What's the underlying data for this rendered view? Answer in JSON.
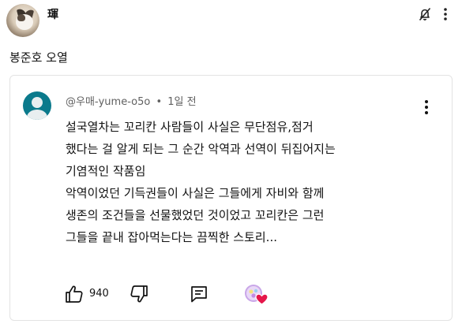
{
  "post": {
    "username": "琿",
    "text": "봉준호 오열"
  },
  "comment": {
    "handle": "@우매-yume-o5o",
    "dot": "•",
    "time": "1일 전",
    "lines": [
      "설국열차는 꼬리칸 사람들이 사실은 무단점유,점거",
      "했다는 걸 알게 되는 그 순간 악역과 선역이 뒤집어지는",
      "기염적인 작품임",
      "악역이었던 기득권들이 사실은 그들에게 자비와 함께",
      "생존의 조건들을 선물했었던 것이었고 꼬리칸은 그런",
      "그들을 끝내 잡아먹는다는 끔찍한 스토리..."
    ],
    "like_count": "940"
  },
  "icons": {
    "notifications_off": "no-notification-icon",
    "more": "more-vert-icon",
    "like": "thumbs-up-icon",
    "dislike": "thumbs-down-icon",
    "reply": "comment-icon",
    "creator_heart": "creator-heart-icon"
  },
  "colors": {
    "comment_avatar": "#0b7a8c",
    "heart": "#e5164a"
  }
}
